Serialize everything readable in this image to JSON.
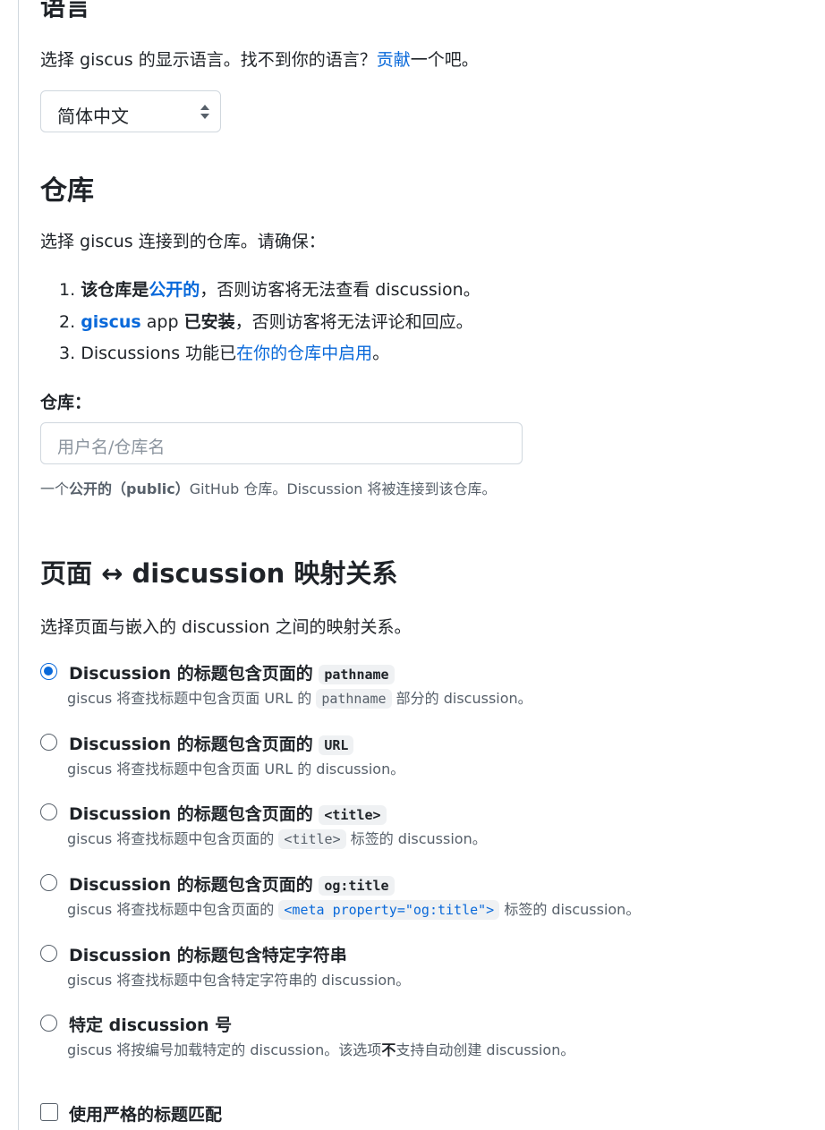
{
  "language": {
    "heading": "语言",
    "desc_prefix": "选择 giscus 的显示语言。找不到你的语言？",
    "contribute_link": "贡献",
    "desc_suffix": "一个吧。",
    "selected": "简体中文"
  },
  "repository": {
    "heading": "仓库",
    "desc": "选择 giscus 连接到的仓库。请确保：",
    "items": [
      {
        "num": "1.",
        "strong": "该仓库是",
        "link": "公开的",
        "rest": "，否则访客将无法查看 discussion。"
      },
      {
        "num": "2.",
        "link": "giscus",
        "mid": " app ",
        "strong": "已安装",
        "rest": "，否则访客将无法评论和回应。"
      },
      {
        "num": "3.",
        "lead": "Discussions 功能已",
        "link": "在你的仓库中启用",
        "rest": "。"
      }
    ],
    "field_label": "仓库：",
    "placeholder": "用户名/仓库名",
    "hint_prefix": "一个",
    "hint_strong": "公开的（public）",
    "hint_suffix": "GitHub 仓库。Discussion 将被连接到该仓库。"
  },
  "mapping": {
    "heading": "页面 ↔ discussion 映射关系",
    "desc": "选择页面与嵌入的 discussion 之间的映射关系。",
    "options": [
      {
        "title": "Discussion 的标题包含页面的",
        "title_code": "pathname",
        "desc_a": "giscus 将查找标题中包含页面 URL 的",
        "desc_code": "pathname",
        "desc_b": "部分的 discussion。",
        "checked": true
      },
      {
        "title": "Discussion 的标题包含页面的",
        "title_code": "URL",
        "desc_a": "giscus 将查找标题中包含页面 URL 的 discussion。",
        "checked": false
      },
      {
        "title": "Discussion 的标题包含页面的",
        "title_code": "<title>",
        "desc_a": "giscus 将查找标题中包含页面的",
        "desc_code": "<title>",
        "desc_b": "标签的 discussion。",
        "checked": false
      },
      {
        "title": "Discussion 的标题包含页面的",
        "title_code": "og:title",
        "desc_a": "giscus 将查找标题中包含页面的",
        "desc_code": "<meta property=\"og:title\">",
        "desc_b": "标签的 discussion。",
        "checked": false
      },
      {
        "title": "Discussion 的标题包含特定字符串",
        "desc_a": "giscus 将查找标题中包含特定字符串的 discussion。",
        "checked": false
      },
      {
        "title": "特定 discussion 号",
        "desc_a": "giscus 将按编号加载特定的 discussion。该选项",
        "desc_strong": "不",
        "desc_b": "支持自动创建 discussion。",
        "checked": false
      }
    ],
    "strict_label": "使用严格的标题匹配"
  }
}
